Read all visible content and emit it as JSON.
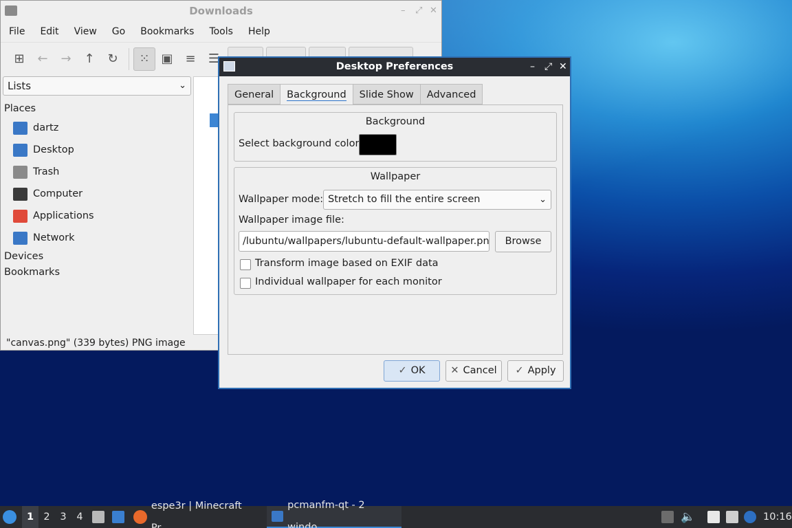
{
  "file_manager": {
    "title": "Downloads",
    "menu": [
      "File",
      "Edit",
      "View",
      "Go",
      "Bookmarks",
      "Tools",
      "Help"
    ],
    "side_pane_mode": "Lists",
    "places_header": "Places",
    "places": [
      {
        "label": "dartz",
        "icon": "home-folder-icon",
        "color": "#3a78c6"
      },
      {
        "label": "Desktop",
        "icon": "desktop-icon",
        "color": "#3a78c6"
      },
      {
        "label": "Trash",
        "icon": "trash-icon",
        "color": "#8a8a8a"
      },
      {
        "label": "Computer",
        "icon": "computer-icon",
        "color": "#3a3a3a"
      },
      {
        "label": "Applications",
        "icon": "applications-icon",
        "color": "#e04a3a"
      },
      {
        "label": "Network",
        "icon": "network-icon",
        "color": "#3a78c6"
      }
    ],
    "devices_header": "Devices",
    "bookmarks_header": "Bookmarks",
    "status": "\"canvas.png\" (339 bytes) PNG image"
  },
  "dialog": {
    "title": "Desktop Preferences",
    "tabs": [
      "General",
      "Background",
      "Slide Show",
      "Advanced"
    ],
    "active_tab": "Background",
    "background_group": "Background",
    "select_color_label": "Select background color:",
    "background_color": "#000000",
    "wallpaper_group": "Wallpaper",
    "wallpaper_mode_label": "Wallpaper mode:",
    "wallpaper_mode": "Stretch to fill the entire screen",
    "wallpaper_file_label": "Wallpaper image file:",
    "wallpaper_file": "/lubuntu/wallpapers/lubuntu-default-wallpaper.png",
    "browse": "Browse",
    "exif_label": "Transform image based on EXIF data",
    "exif_checked": false,
    "per_monitor_label": "Individual wallpaper for each monitor",
    "per_monitor_checked": false,
    "ok": "OK",
    "cancel": "Cancel",
    "apply": "Apply"
  },
  "taskbar": {
    "workspaces": [
      "1",
      "2",
      "3",
      "4"
    ],
    "current_workspace": "1",
    "windows": [
      {
        "label": "espe3r | Minecraft Pr...",
        "icon": "firefox-icon"
      },
      {
        "label": "pcmanfm-qt - 2 windo...",
        "icon": "folder-icon"
      }
    ],
    "clock": "10:16"
  }
}
